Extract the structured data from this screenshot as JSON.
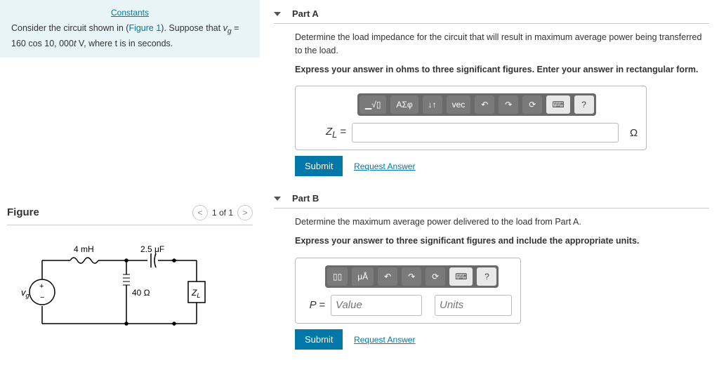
{
  "links": {
    "constants": "Constants",
    "figure": "Figure 1",
    "request_answer": "Request Answer"
  },
  "problem": {
    "pre": "Consider the circuit shown in (",
    "post": "). Suppose that ",
    "eq": "v_g = 160 cos 10,000t V",
    "tail": ", where t is in seconds."
  },
  "figure": {
    "title": "Figure",
    "nav": "1 of 1",
    "L": "4 mH",
    "C": "2.5 μF",
    "R": "40 Ω",
    "src": "v_g",
    "load": "Z_L"
  },
  "partA": {
    "title": "Part A",
    "q": "Determine the load impedance for the circuit that will result in maximum average power being transferred to the load.",
    "dir": "Express your answer in ohms to three significant figures. Enter your answer in rectangular form.",
    "var": "Z_L =",
    "unit": "Ω",
    "toolbar": {
      "t1": "▁√▯",
      "t2": "ΑΣφ",
      "t3": "↓↑",
      "t4": "vec",
      "undo": "↶",
      "redo": "↷",
      "reset": "⟳",
      "kb": "⌨",
      "help": "?"
    }
  },
  "partB": {
    "title": "Part B",
    "q": "Determine the maximum average power delivered to the load from Part A.",
    "dir": "Express your answer to three significant figures and include the appropriate units.",
    "var": "P =",
    "val_ph": "Value",
    "un_ph": "Units",
    "toolbar": {
      "t1": "▯▯",
      "t2": "μÅ",
      "undo": "↶",
      "redo": "↷",
      "reset": "⟳",
      "kb": "⌨",
      "help": "?"
    }
  },
  "buttons": {
    "submit": "Submit"
  }
}
